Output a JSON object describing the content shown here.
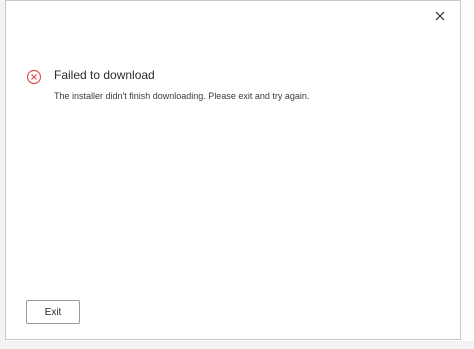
{
  "dialog": {
    "title": "Failed to download",
    "message": "The installer didn't finish downloading. Please exit and try again.",
    "exit_label": "Exit",
    "close_icon": "close-icon",
    "status_icon": "error-circle-x-icon"
  },
  "colors": {
    "error": "#d9534f",
    "text_primary": "#2b2b2b",
    "text_secondary": "#3c3c3c",
    "border": "#c8c8c8"
  }
}
